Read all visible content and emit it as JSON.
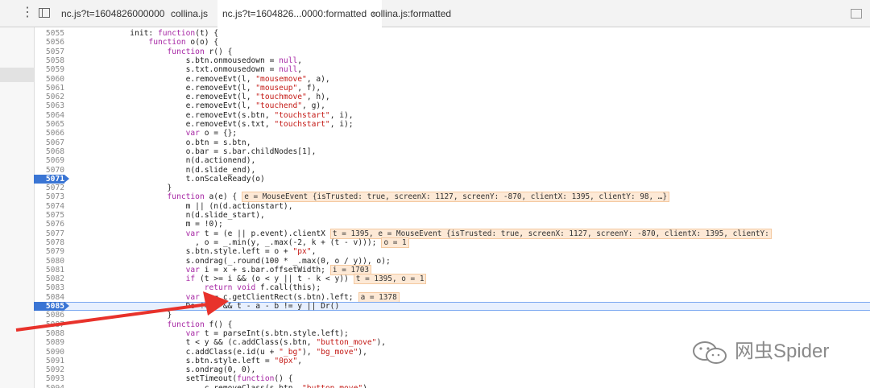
{
  "tabs": [
    {
      "label": "nc.js?t=1604826000000",
      "active": false
    },
    {
      "label": "collina.js",
      "active": false
    },
    {
      "label": "nc.js?t=1604826...0000:formatted",
      "active": true,
      "close": "×"
    },
    {
      "label": "collina.js:formatted",
      "active": false
    }
  ],
  "lines": [
    {
      "n": "5055",
      "t": "            init: function(t) {"
    },
    {
      "n": "5056",
      "t": "                function o(o) {"
    },
    {
      "n": "5057",
      "t": "                    function r() {"
    },
    {
      "n": "5058",
      "t": "                        s.btn.onmousedown = null,"
    },
    {
      "n": "5059",
      "t": "                        s.txt.onmousedown = null,"
    },
    {
      "n": "5060",
      "t": "                        e.removeEvt(l, \"mousemove\", a),"
    },
    {
      "n": "5061",
      "t": "                        e.removeEvt(l, \"mouseup\", f),"
    },
    {
      "n": "5062",
      "t": "                        e.removeEvt(l, \"touchmove\", h),"
    },
    {
      "n": "5063",
      "t": "                        e.removeEvt(l, \"touchend\", g),"
    },
    {
      "n": "5064",
      "t": "                        e.removeEvt(s.btn, \"touchstart\", i),"
    },
    {
      "n": "5065",
      "t": "                        e.removeEvt(s.txt, \"touchstart\", i);"
    },
    {
      "n": "5066",
      "t": "                        var o = {};"
    },
    {
      "n": "5067",
      "t": "                        o.btn = s.btn,"
    },
    {
      "n": "5068",
      "t": "                        o.bar = s.bar.childNodes[1],"
    },
    {
      "n": "5069",
      "t": "                        n(d.actionend),"
    },
    {
      "n": "5070",
      "t": "                        n(d.slide_end),"
    },
    {
      "n": "5071",
      "t": "                        t.onScaleReady(o)",
      "bp": true
    },
    {
      "n": "5072",
      "t": "                    }"
    },
    {
      "n": "5073",
      "t": "                    function a(e) {",
      "ann": "e = MouseEvent {isTrusted: true, screenX: 1127, screenY: -870, clientX: 1395, clientY: 98, …}"
    },
    {
      "n": "5074",
      "t": "                        m || (n(d.actionstart),"
    },
    {
      "n": "5075",
      "t": "                        n(d.slide_start),"
    },
    {
      "n": "5076",
      "t": "                        m = !0);"
    },
    {
      "n": "5077",
      "t": "                        var t = (e || p.event).clientX",
      "ann": "t = 1395, e = MouseEvent {isTrusted: true, screenX: 1127, screenY: -870, clientX: 1395, clientY:"
    },
    {
      "n": "5078",
      "t": "                          , o = _.min(y, _.max(-2, k + (t - v)));",
      "ann": "o = 1"
    },
    {
      "n": "5079",
      "t": "                        s.btn.style.left = o + \"px\","
    },
    {
      "n": "5080",
      "t": "                        s.ondrag(_.round(100 * _.max(0, o / y)), o);"
    },
    {
      "n": "5081",
      "t": "                        var i = x + s.bar.offsetWidth;",
      "ann": "i = 1703"
    },
    {
      "n": "5082",
      "t": "                        if (t >= i && (o < y || t - k < y))",
      "ann": "t = 1395, o = 1"
    },
    {
      "n": "5083",
      "t": "                            return void f.call(this);"
    },
    {
      "n": "5084",
      "t": "                        var a = c.getClientRect(s.btn).left;",
      "ann": "a = 1378"
    },
    {
      "n": "5085",
      "t": "                        Do != y && t - a - b != y || Dr()",
      "bp": true,
      "current": true
    },
    {
      "n": "5086",
      "t": "                    }"
    },
    {
      "n": "5087",
      "t": "                    function f() {"
    },
    {
      "n": "5088",
      "t": "                        var t = parseInt(s.btn.style.left);"
    },
    {
      "n": "5089",
      "t": "                        t < y && (c.addClass(s.btn, \"button_move\"),"
    },
    {
      "n": "5090",
      "t": "                        c.addClass(e.id(u + \"_bg\"), \"bg_move\"),"
    },
    {
      "n": "5091",
      "t": "                        s.btn.style.left = \"0px\","
    },
    {
      "n": "5092",
      "t": "                        s.ondrag(0, 0),"
    },
    {
      "n": "5093",
      "t": "                        setTimeout(function() {"
    },
    {
      "n": "5094",
      "t": "                            c.removeClass(s.btn, \"button_move\"),"
    }
  ],
  "watermark": {
    "text": "网虫Spider",
    "icon": "wechat-icon"
  },
  "colors": {
    "breakpoint": "#3a75d4",
    "arrow": "#e8322b",
    "annotation_bg": "#fde9d6"
  }
}
